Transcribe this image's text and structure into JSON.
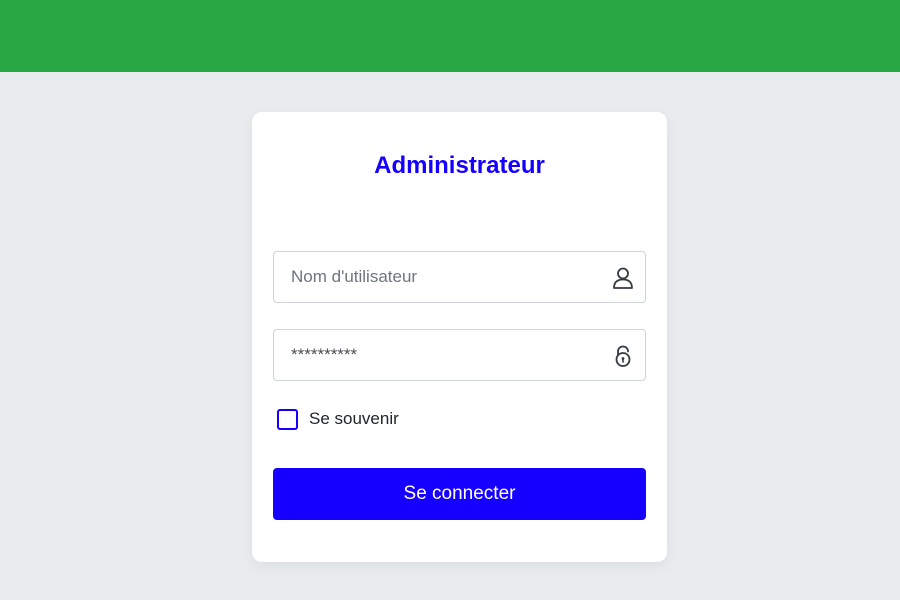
{
  "login": {
    "title": "Administrateur",
    "username_placeholder": "Nom d'utilisateur",
    "password_value": "**********",
    "remember_label": "Se souvenir",
    "remember_checked": false,
    "submit_label": "Se connecter"
  },
  "icons": {
    "username": "user-icon",
    "password": "lock-icon"
  },
  "colors": {
    "header": "#28a745",
    "accent": "#1500ff",
    "background": "#e9ecef",
    "card": "#ffffff"
  }
}
